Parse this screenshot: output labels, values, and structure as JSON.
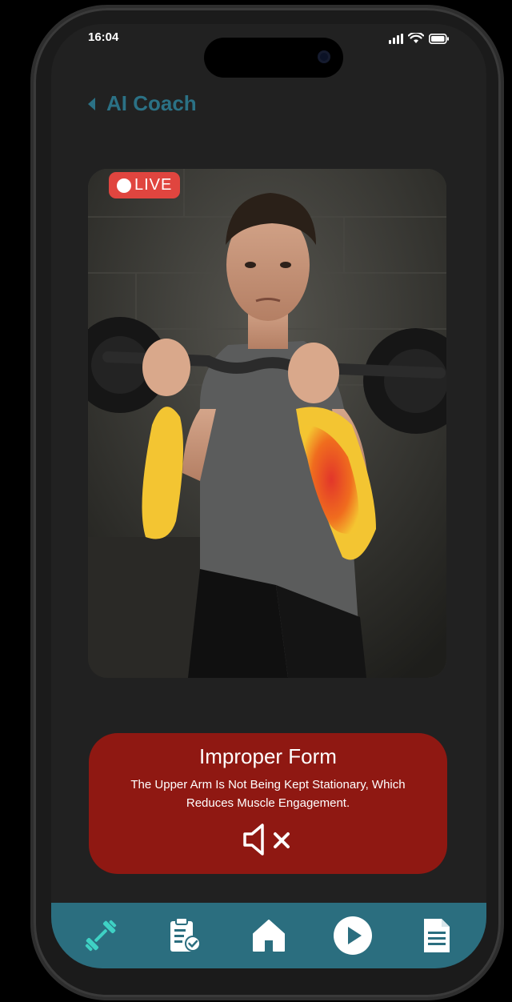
{
  "status_bar": {
    "time": "16:04"
  },
  "header": {
    "title": "AI Coach",
    "back_icon": "chevron-left-icon"
  },
  "video": {
    "live_label": "LIVE",
    "subject": "man performing barbell curl with forearm muscle heatmap overlay"
  },
  "feedback": {
    "title": "Improper Form",
    "message": "The Upper Arm Is Not Being Kept Stationary, Which Reduces Muscle Engagement.",
    "sound_icon": "volume-muted-icon"
  },
  "nav": {
    "items": [
      {
        "name": "workout",
        "icon": "dumbbell-icon",
        "active": true
      },
      {
        "name": "plan",
        "icon": "clipboard-check-icon",
        "active": false
      },
      {
        "name": "home",
        "icon": "home-icon",
        "active": false
      },
      {
        "name": "play",
        "icon": "play-circle-icon",
        "active": false
      },
      {
        "name": "document",
        "icon": "document-icon",
        "active": false
      }
    ]
  },
  "colors": {
    "accent": "#2b7185",
    "nav_bg": "#2b6e7f",
    "alert_bg": "#8f1812",
    "live_badge": "#e0453f",
    "active_icon": "#3fd1c4"
  }
}
